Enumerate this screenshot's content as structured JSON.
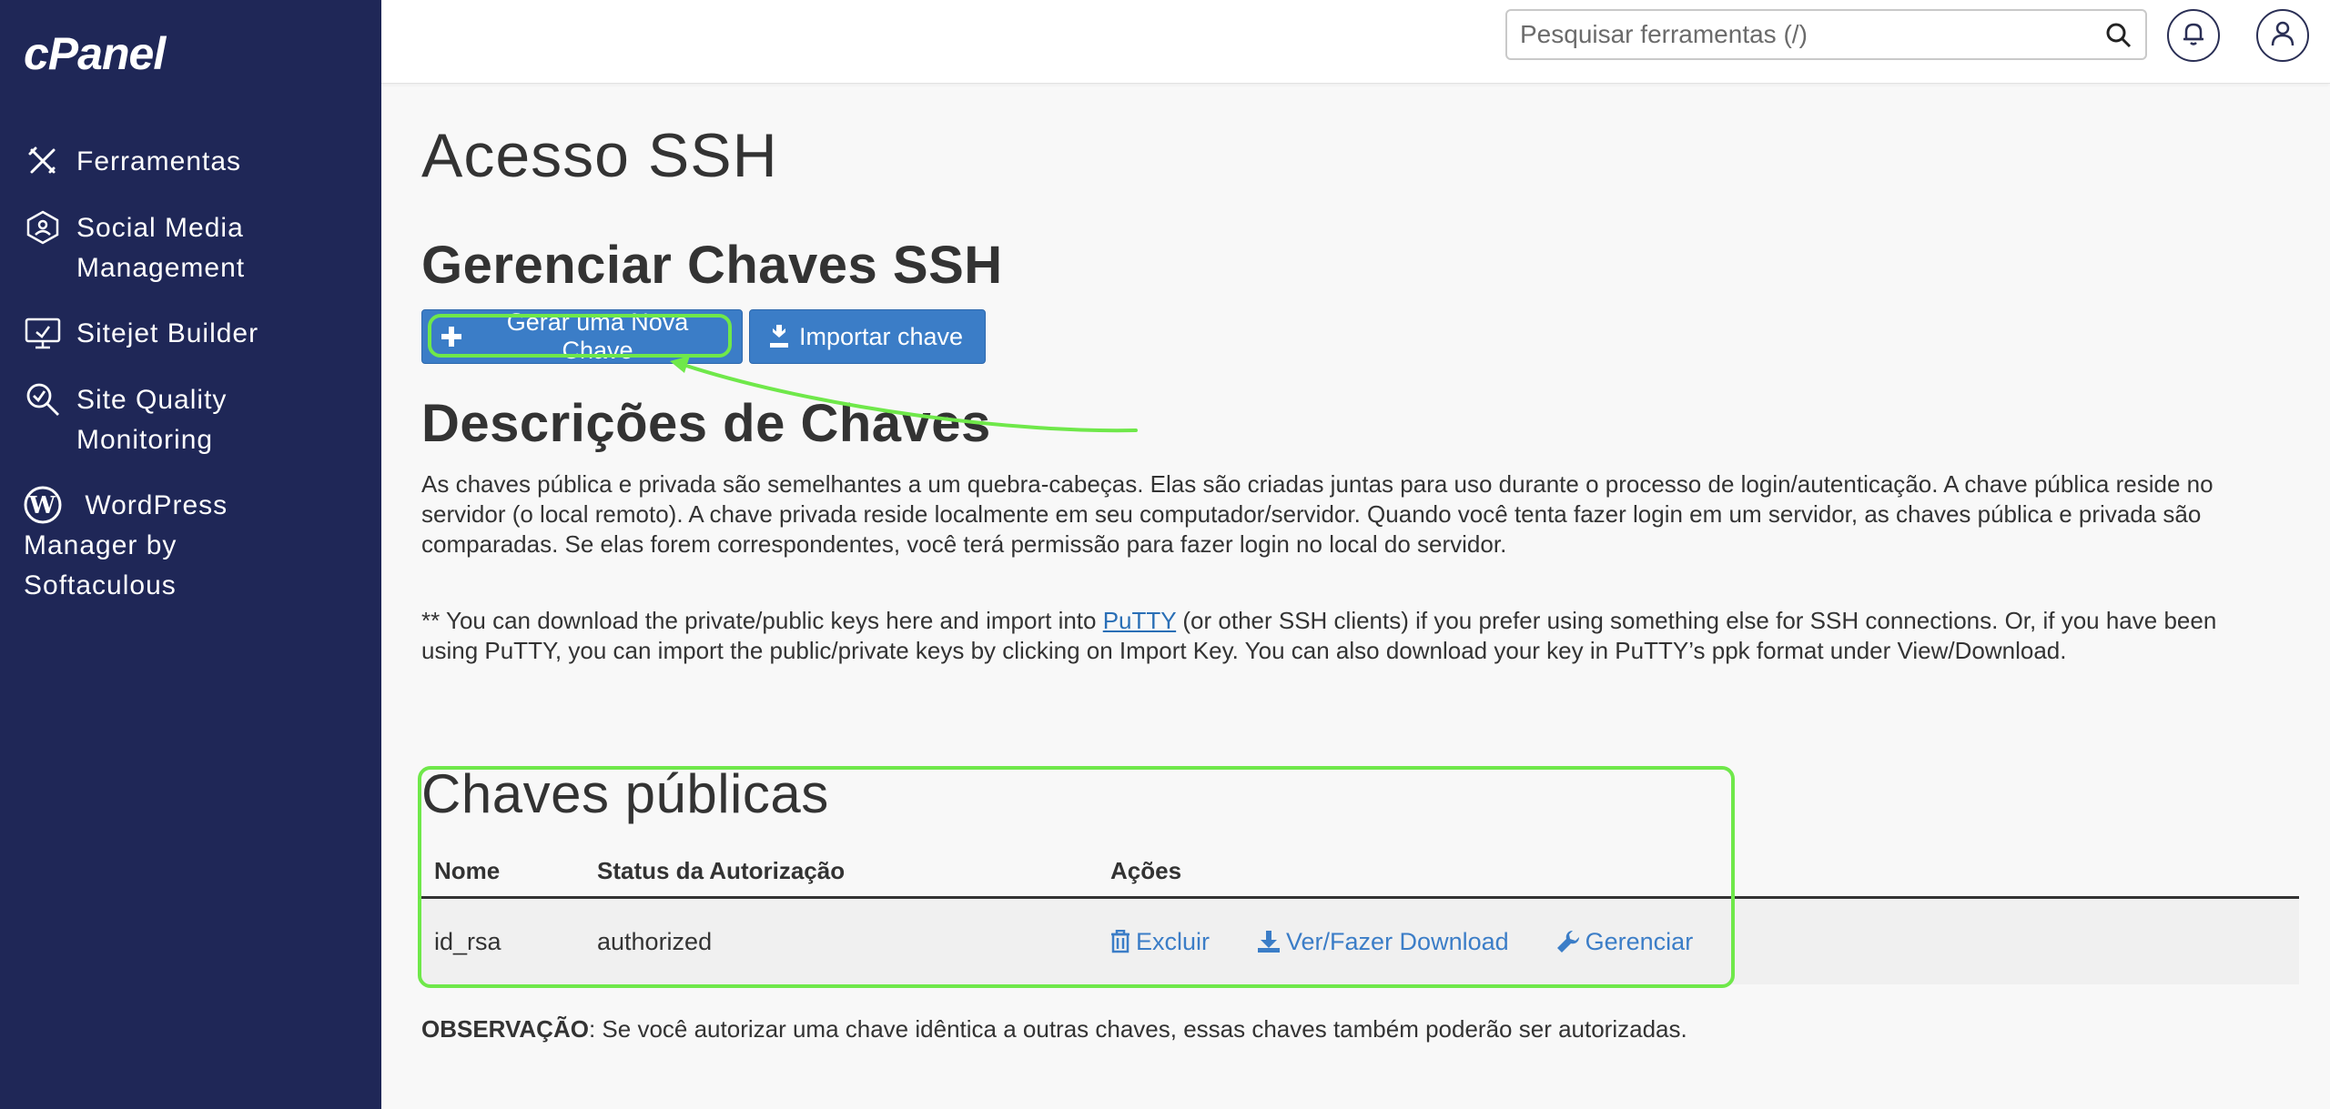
{
  "sidebar": {
    "logo": "cPanel",
    "items": [
      {
        "label": "Ferramentas",
        "icon": "tools-icon"
      },
      {
        "label": "Social Media\nManagement",
        "icon": "social-media-icon"
      },
      {
        "label": "Sitejet Builder",
        "icon": "monitor-icon"
      },
      {
        "label": "Site Quality\nMonitoring",
        "icon": "magnifier-check-icon"
      },
      {
        "label": "WordPress\nManager by\nSoftaculous",
        "icon": "wordpress-icon"
      }
    ]
  },
  "header": {
    "search_placeholder": "Pesquisar ferramentas (/)",
    "notifications_icon": "bell-icon",
    "user_icon": "user-icon"
  },
  "page": {
    "title": "Acesso SSH",
    "manage_heading": "Gerenciar Chaves SSH",
    "generate_button": "Gerar uma Nova Chave",
    "import_button": "Importar chave",
    "descriptions_heading": "Descrições de Chaves",
    "description_text": "As chaves pública e privada são semelhantes a um quebra-cabeças. Elas são criadas juntas para uso durante o processo de login/autenticação. A chave pública reside no servidor (o local remoto). A chave privada reside localmente em seu computador/servidor. Quando você tenta fazer login em um servidor, as chaves pública e privada são comparadas. Se elas forem correspondentes, você terá permissão para fazer login no local do servidor.",
    "putty_prefix": "** You can download the private/public keys here and import into ",
    "putty_link": "PuTTY",
    "putty_suffix": " (or other SSH clients) if you prefer using something else for SSH connections. Or, if you have been using PuTTY, you can import the public/private keys by clicking on Import Key. You can also download your key in PuTTY’s ppk format under View/Download.",
    "public_keys_heading": "Chaves públicas",
    "note_label": "OBSERVAÇÃO",
    "note_text": ": Se você autorizar uma chave idêntica a outras chaves, essas chaves também poderão ser autorizadas."
  },
  "table": {
    "columns": [
      "Nome",
      "Status da Autorização",
      "Ações"
    ],
    "rows": [
      {
        "name": "id_rsa",
        "status": "authorized",
        "actions": [
          "Excluir",
          "Ver/Fazer Download",
          "Gerenciar"
        ]
      }
    ]
  },
  "colors": {
    "sidebar_bg": "#1f2757",
    "button_bg": "#3b7dc7",
    "link": "#3b7dc7",
    "annotation_green": "#6fe84a"
  }
}
